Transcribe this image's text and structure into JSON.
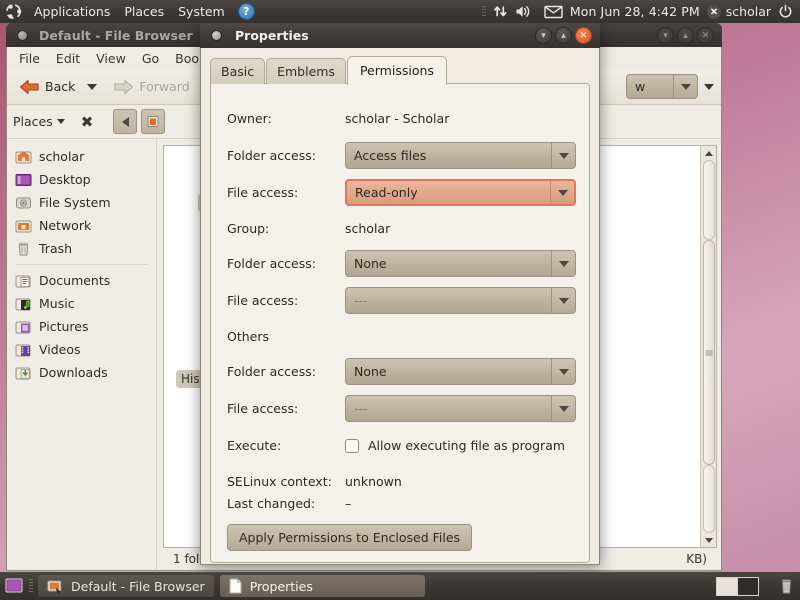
{
  "top_panel": {
    "logo_icon": "ubuntu-logo-icon",
    "menus": [
      "Applications",
      "Places",
      "System"
    ],
    "help_label": "?",
    "indicators": [
      "grip-handle",
      "network-icon",
      "volume-icon",
      "mail-icon"
    ],
    "clock": "Mon Jun 28,  4:42 PM",
    "user_name": "scholar",
    "power_icon": "power-icon"
  },
  "file_browser": {
    "title": "Default - File Browser",
    "menus": [
      "File",
      "Edit",
      "View",
      "Go",
      "Bookmarks"
    ],
    "toolbar": {
      "back_label": "Back",
      "forward_label": "Forward"
    },
    "location": {
      "places_label": "Places",
      "close_icon": "close-pane-icon",
      "view_value": "w"
    },
    "sidebar": {
      "items": [
        {
          "label": "scholar",
          "icon": "home-folder-icon"
        },
        {
          "label": "Desktop",
          "icon": "desktop-icon"
        },
        {
          "label": "File System",
          "icon": "harddisk-icon"
        },
        {
          "label": "Network",
          "icon": "network-icon"
        },
        {
          "label": "Trash",
          "icon": "trash-icon"
        }
      ],
      "items2": [
        {
          "label": "Documents",
          "icon": "documents-icon"
        },
        {
          "label": "Music",
          "icon": "music-icon"
        },
        {
          "label": "Pictures",
          "icon": "pictures-icon"
        },
        {
          "label": "Videos",
          "icon": "videos-icon"
        },
        {
          "label": "Downloads",
          "icon": "downloads-icon"
        }
      ]
    },
    "view_items": [
      {
        "label": "B"
      },
      {
        "label": "His"
      }
    ],
    "status_left": "1 folde",
    "status_right": "KB)"
  },
  "properties_dialog": {
    "title": "Properties",
    "window_buttons": [
      "minimize-icon",
      "maximize-icon",
      "close-icon"
    ],
    "tabs": [
      {
        "label": "Basic",
        "active": false
      },
      {
        "label": "Emblems",
        "active": false
      },
      {
        "label": "Permissions",
        "active": true
      }
    ],
    "owner": {
      "section_label": "Owner:",
      "value": "scholar - Scholar",
      "folder_access_label": "Folder access:",
      "folder_access_value": "Access files",
      "file_access_label": "File access:",
      "file_access_value": "Read-only",
      "file_access_highlighted": true
    },
    "group": {
      "section_label": "Group:",
      "value": "scholar",
      "folder_access_label": "Folder access:",
      "folder_access_value": "None",
      "file_access_label": "File access:",
      "file_access_value": "---"
    },
    "others": {
      "section_label": "Others",
      "folder_access_label": "Folder access:",
      "folder_access_value": "None",
      "file_access_label": "File access:",
      "file_access_value": "---"
    },
    "execute": {
      "label": "Execute:",
      "checkbox_label": "Allow executing file as program",
      "checked": false
    },
    "selinux_label": "SELinux context:",
    "selinux_value": "unknown",
    "last_changed_label": "Last changed:",
    "last_changed_value": "–",
    "apply_button": "Apply Permissions to Enclosed Files"
  },
  "taskbar": {
    "tasks": [
      {
        "label": "Default - File Browser",
        "icon": "file-browser-icon",
        "active": false
      },
      {
        "label": "Properties",
        "icon": "document-icon",
        "active": true
      }
    ],
    "workspaces": 2,
    "trash_icon": "trash-icon"
  },
  "colors": {
    "panel_bg": "#3b3733",
    "dialog_bg": "#f4f1ea",
    "window_bg": "#efece5",
    "accent_close": "#dd5520",
    "highlight_border": "#e0775a",
    "highlight_fill": "#e3a98d",
    "desktop": "#b4708d"
  }
}
